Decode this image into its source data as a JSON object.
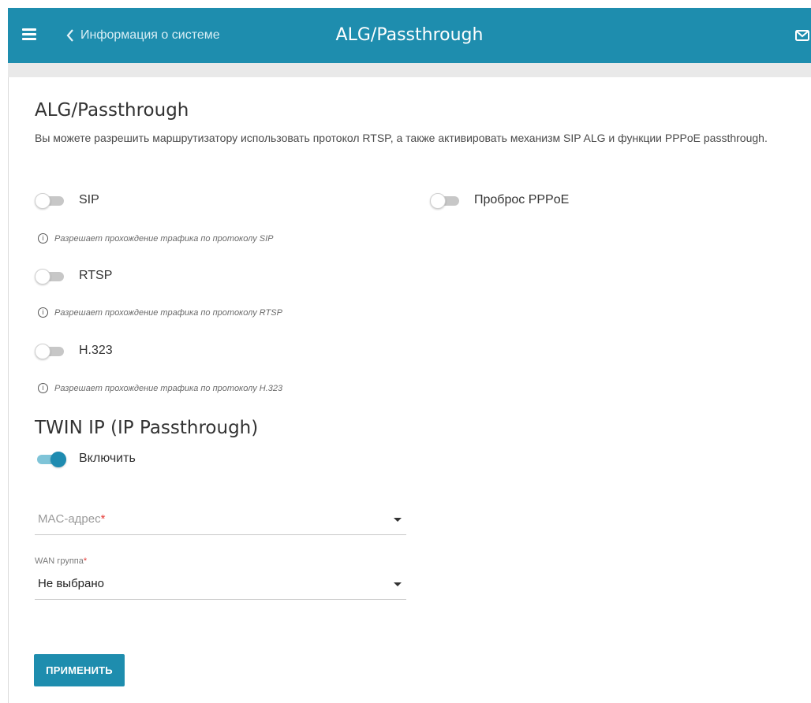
{
  "header": {
    "back_label": "Информация о системе",
    "title": "ALG/Passthrough",
    "menu_icon": "hamburger-icon",
    "mail_icon": "mail-icon",
    "background_color": "#1e8dae"
  },
  "alg_section": {
    "title": "ALG/Passthrough",
    "description": "Вы можете разрешить маршрутизатору использовать протокол RTSP, а также активировать механизм SIP ALG и функции PPPoE passthrough.",
    "toggles": [
      {
        "label": "SIP",
        "enabled": false,
        "hint": "Разрешает прохождение трафика по протоколу SIP"
      },
      {
        "label": "RTSP",
        "enabled": false,
        "hint": "Разрешает прохождение трафика по протоколу RTSP"
      },
      {
        "label": "H.323",
        "enabled": false,
        "hint": "Разрешает прохождение трафика по протоколу H.323"
      }
    ],
    "pppoe": {
      "label": "Проброс PPPoE",
      "enabled": false
    }
  },
  "twin_ip": {
    "title": "TWIN IP (IP Passthrough)",
    "enable_label": "Включить",
    "enabled": true,
    "mac": {
      "placeholder": "MAC-адрес",
      "required_mark": "*",
      "value": ""
    },
    "wan_group": {
      "label": "WAN группа",
      "required_mark": "*",
      "value": "Не выбрано"
    }
  },
  "actions": {
    "apply_label": "ПРИМЕНИТЬ"
  },
  "colors": {
    "accent": "#1e8dae",
    "toggle_on": "#1f8bb0",
    "required": "#e53935"
  }
}
